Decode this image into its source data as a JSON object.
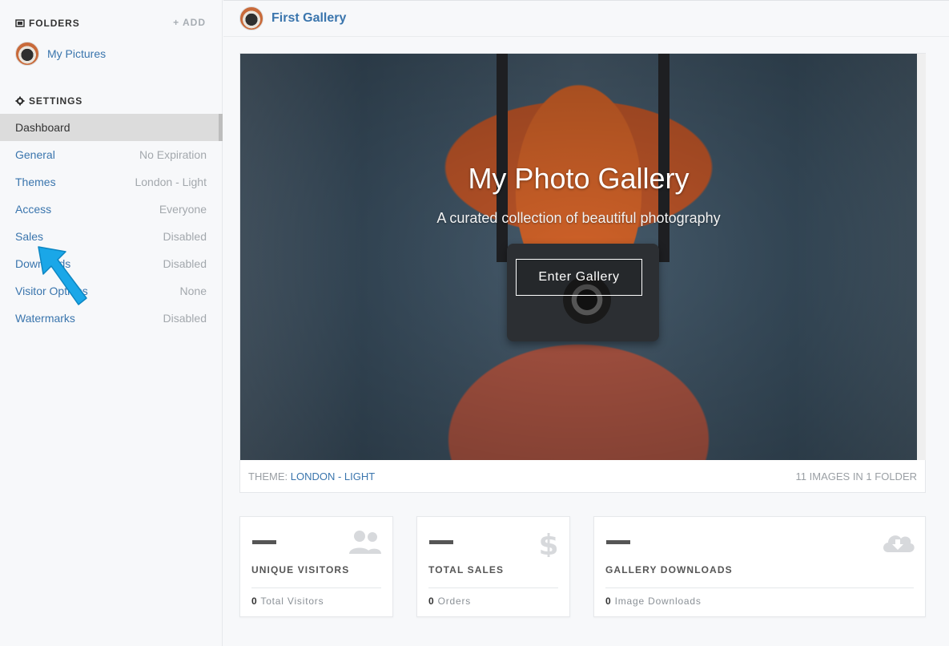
{
  "sidebar": {
    "folders_heading": "FOLDERS",
    "add_label": "+ ADD",
    "folders": [
      {
        "label": "My Pictures"
      }
    ],
    "settings_heading": "SETTINGS",
    "items": [
      {
        "label": "Dashboard",
        "value": ""
      },
      {
        "label": "General",
        "value": "No Expiration"
      },
      {
        "label": "Themes",
        "value": "London - Light"
      },
      {
        "label": "Access",
        "value": "Everyone"
      },
      {
        "label": "Sales",
        "value": "Disabled"
      },
      {
        "label": "Downloads",
        "value": "Disabled"
      },
      {
        "label": "Visitor Options",
        "value": "None"
      },
      {
        "label": "Watermarks",
        "value": "Disabled"
      }
    ]
  },
  "header": {
    "title": "First Gallery"
  },
  "hero": {
    "title": "My Photo Gallery",
    "subtitle": "A curated collection of beautiful photography",
    "button_label": "Enter Gallery",
    "theme_prefix": "THEME: ",
    "theme_name": "LONDON - LIGHT",
    "image_count": "11 IMAGES IN 1 FOLDER"
  },
  "stats": [
    {
      "title": "UNIQUE VISITORS",
      "count": "0",
      "footer": " Total Visitors",
      "icon": "users-icon"
    },
    {
      "title": "TOTAL SALES",
      "count": "0",
      "footer": " Orders",
      "icon": "dollar-icon"
    },
    {
      "title": "GALLERY DOWNLOADS",
      "count": "0",
      "footer": " Image Downloads",
      "icon": "cloud-download-icon"
    }
  ],
  "colors": {
    "link": "#3a75ad",
    "muted": "#a3a8ad",
    "active_bg": "#dcdcdc",
    "pointer": "#1aa7e8"
  }
}
